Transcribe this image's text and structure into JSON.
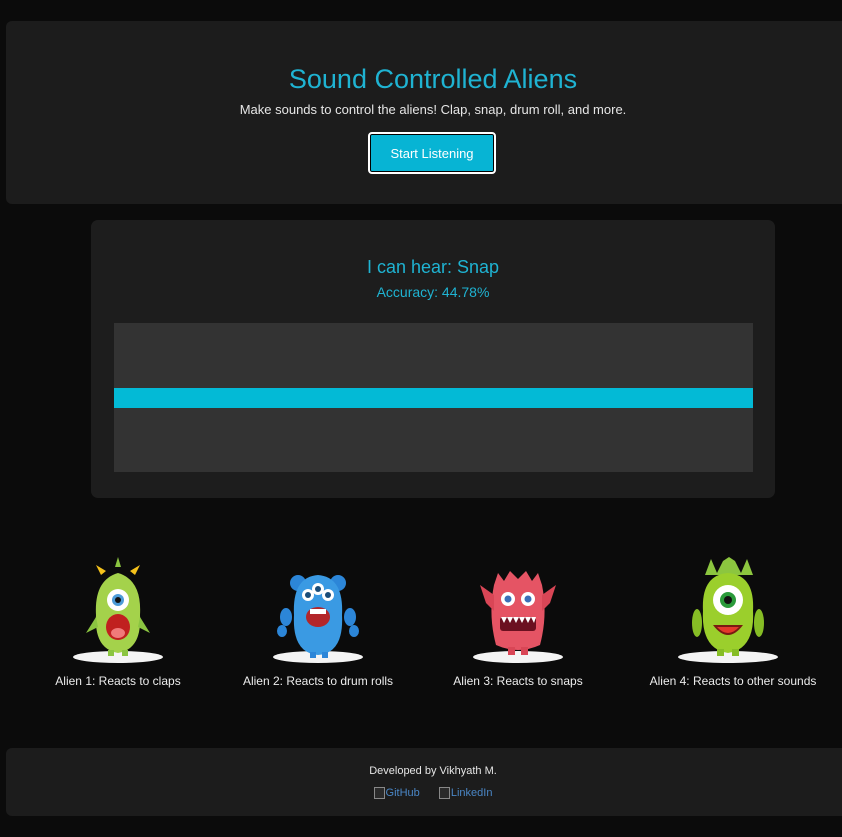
{
  "header": {
    "title": "Sound Controlled Aliens",
    "subtitle": "Make sounds to control the aliens! Clap, snap, drum roll, and more.",
    "start_button": "Start Listening"
  },
  "detector": {
    "hear_text": "I can hear: Snap",
    "accuracy_text": "Accuracy: 44.78%",
    "level": 1.0
  },
  "aliens": [
    {
      "caption": "Alien 1: Reacts to claps",
      "icon": "green-one-eyed-alien-icon"
    },
    {
      "caption": "Alien 2: Reacts to drum rolls",
      "icon": "blue-three-eyed-alien-icon"
    },
    {
      "caption": "Alien 3: Reacts to snaps",
      "icon": "red-furry-alien-icon"
    },
    {
      "caption": "Alien 4: Reacts to other sounds",
      "icon": "lime-cyclops-alien-icon"
    }
  ],
  "footer": {
    "developer": "Developed by Vikhyath M.",
    "links": [
      "GitHub",
      "LinkedIn"
    ]
  },
  "colors": {
    "accent": "#1fb3d2",
    "button": "#07b4d4",
    "panel": "#1d1d1d",
    "background": "#0b0b0b"
  }
}
